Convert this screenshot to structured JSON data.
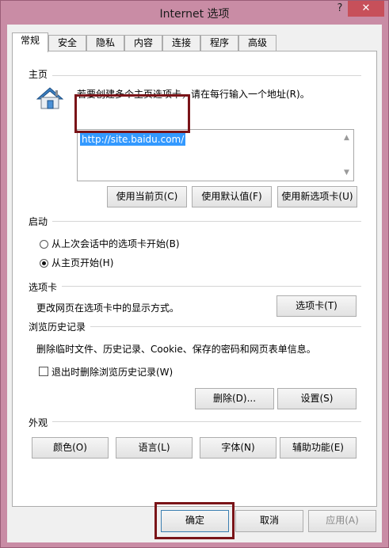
{
  "window": {
    "title": "Internet 选项",
    "help_glyph": "?",
    "close_glyph": "✕"
  },
  "tabs": [
    "常规",
    "安全",
    "隐私",
    "内容",
    "连接",
    "程序",
    "高级"
  ],
  "home": {
    "group_label": "主页",
    "instruction": "若要创建多个主页选项卡，请在每行输入一个地址(R)。",
    "url": "http://site.baidu.com/",
    "buttons": [
      "使用当前页(C)",
      "使用默认值(F)",
      "使用新选项卡(U)"
    ]
  },
  "startup": {
    "group_label": "启动",
    "options": [
      "从上次会话中的选项卡开始(B)",
      "从主页开始(H)"
    ],
    "selected_index": 1
  },
  "tabs_section": {
    "group_label": "选项卡",
    "description": "更改网页在选项卡中的显示方式。",
    "button": "选项卡(T)"
  },
  "history": {
    "group_label": "浏览历史记录",
    "description": "删除临时文件、历史记录、Cookie、保存的密码和网页表单信息。",
    "checkbox_label": "退出时删除浏览历史记录(W)",
    "checked": false,
    "delete_button": "删除(D)...",
    "settings_button": "设置(S)"
  },
  "appearance": {
    "group_label": "外观",
    "buttons": [
      "颜色(O)",
      "语言(L)",
      "字体(N)",
      "辅助功能(E)"
    ]
  },
  "footer": {
    "ok": "确定",
    "cancel": "取消",
    "apply": "应用(A)"
  },
  "colors": {
    "frame": "#c98ca5",
    "close_button": "#c7505a",
    "highlight_box": "#7a1418",
    "selection": "#3399ff"
  }
}
